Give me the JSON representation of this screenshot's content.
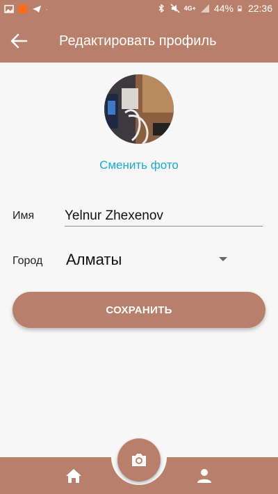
{
  "status_bar": {
    "signal_text": "4G+",
    "battery": "44%",
    "time": "22:36"
  },
  "app_bar": {
    "title": "Редактировать профиль"
  },
  "profile": {
    "change_photo_label": "Сменить фото"
  },
  "form": {
    "name_label": "Имя",
    "name_value": "Yelnur Zhexenov",
    "city_label": "Город",
    "city_value": "Алматы",
    "save_label": "СОХРАНИТЬ"
  },
  "colors": {
    "primary": "#b8806a",
    "link": "#1aa9d8",
    "background": "#f7f7f7"
  },
  "icons": {
    "back": "arrow-left-icon",
    "camera": "camera-icon",
    "home": "home-icon",
    "user": "user-icon"
  }
}
